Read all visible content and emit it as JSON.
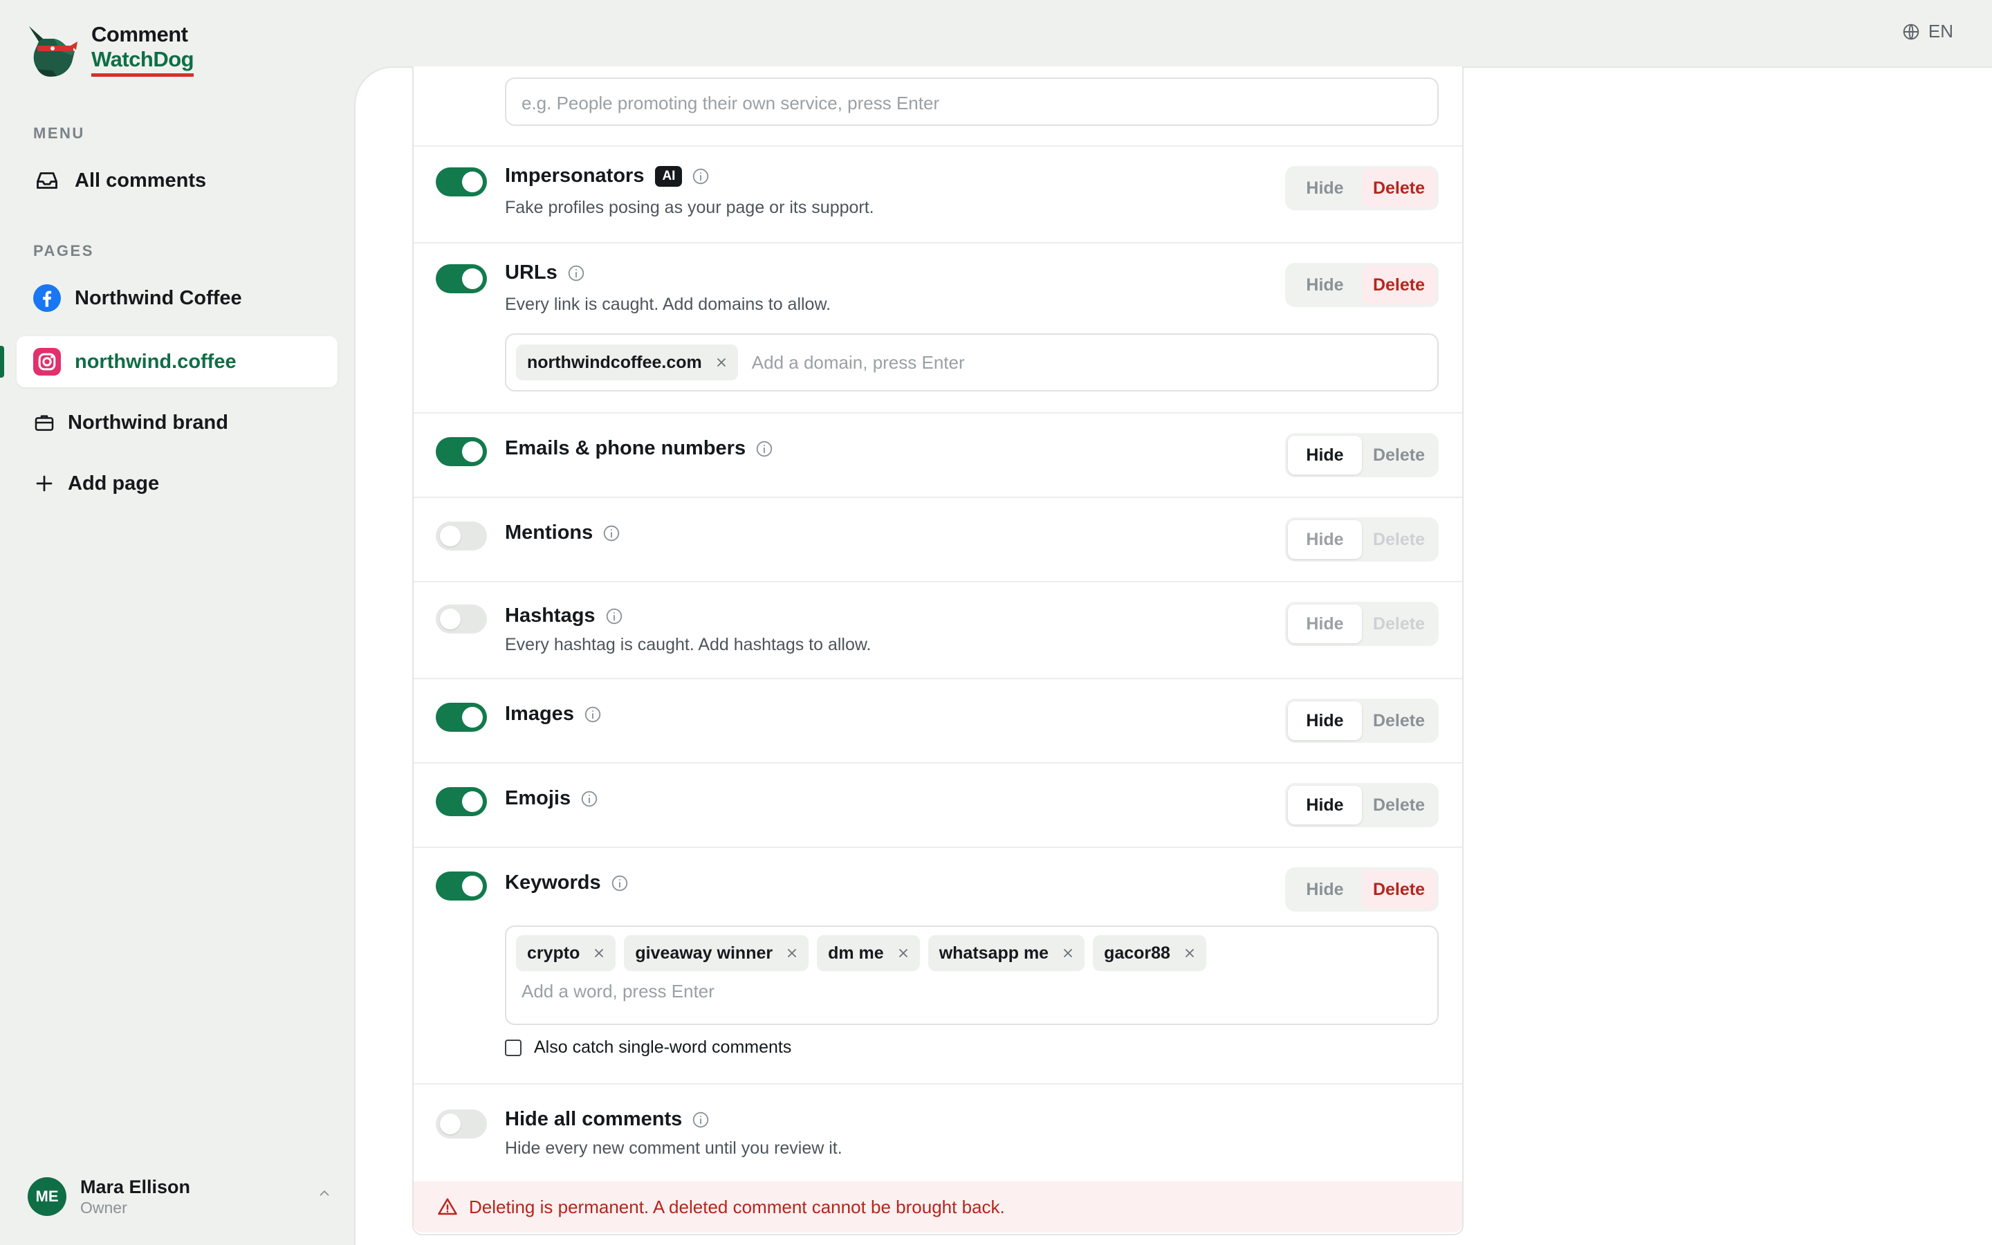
{
  "brand": {
    "line1": "Comment",
    "line2": "WatchDog"
  },
  "language": {
    "label": "EN",
    "icon": "globe-icon"
  },
  "sidebar": {
    "menu_label": "MENU",
    "pages_label": "PAGES",
    "menu_items": [
      {
        "label": "All comments",
        "icon": "inbox-icon"
      }
    ],
    "pages": [
      {
        "label": "Northwind Coffee",
        "icon": "facebook-icon"
      },
      {
        "label": "northwind.coffee",
        "icon": "instagram-icon",
        "active": true
      },
      {
        "label": "Northwind brand",
        "icon": "briefcase-icon"
      },
      {
        "label": "Add page",
        "icon": "plus-icon"
      }
    ]
  },
  "user": {
    "initials": "ME",
    "name": "Mara Ellison",
    "role": "Owner"
  },
  "colors": {
    "accent": "#127a4c",
    "danger": "#b3261e",
    "brand_underline": "#d0342c"
  },
  "top_field": {
    "placeholder": "e.g. People promoting their own service, press Enter"
  },
  "action_labels": {
    "hide": "Hide",
    "delete": "Delete"
  },
  "rules": [
    {
      "id": "impersonators",
      "title": "Impersonators",
      "badge": "AI",
      "description": "Fake profiles posing as your page or its support.",
      "enabled": true,
      "action": "delete"
    },
    {
      "id": "urls",
      "title": "URLs",
      "description": "Every link is caught. Add domains to allow.",
      "enabled": true,
      "action": "delete",
      "chips": [
        "northwindcoffee.com"
      ],
      "input_placeholder": "Add a domain, press Enter"
    },
    {
      "id": "emails",
      "title": "Emails & phone numbers",
      "enabled": true,
      "action": "hide"
    },
    {
      "id": "mentions",
      "title": "Mentions",
      "enabled": false,
      "action": "hide"
    },
    {
      "id": "hashtags",
      "title": "Hashtags",
      "description": "Every hashtag is caught. Add hashtags to allow.",
      "enabled": false,
      "action": "hide"
    },
    {
      "id": "images",
      "title": "Images",
      "enabled": true,
      "action": "hide"
    },
    {
      "id": "emojis",
      "title": "Emojis",
      "enabled": true,
      "action": "hide"
    },
    {
      "id": "keywords",
      "title": "Keywords",
      "enabled": true,
      "action": "delete",
      "chips": [
        "crypto",
        "giveaway winner",
        "dm me",
        "whatsapp me",
        "gacor88"
      ],
      "input_placeholder": "Add a word, press Enter",
      "checkbox_label": "Also catch single-word comments",
      "checkbox_checked": false
    },
    {
      "id": "hide_all",
      "title": "Hide all comments",
      "description": "Hide every new comment until you review it.",
      "enabled": false
    }
  ],
  "alert": {
    "text": "Deleting is permanent. A deleted comment cannot be brought back.",
    "icon": "warning-icon"
  }
}
